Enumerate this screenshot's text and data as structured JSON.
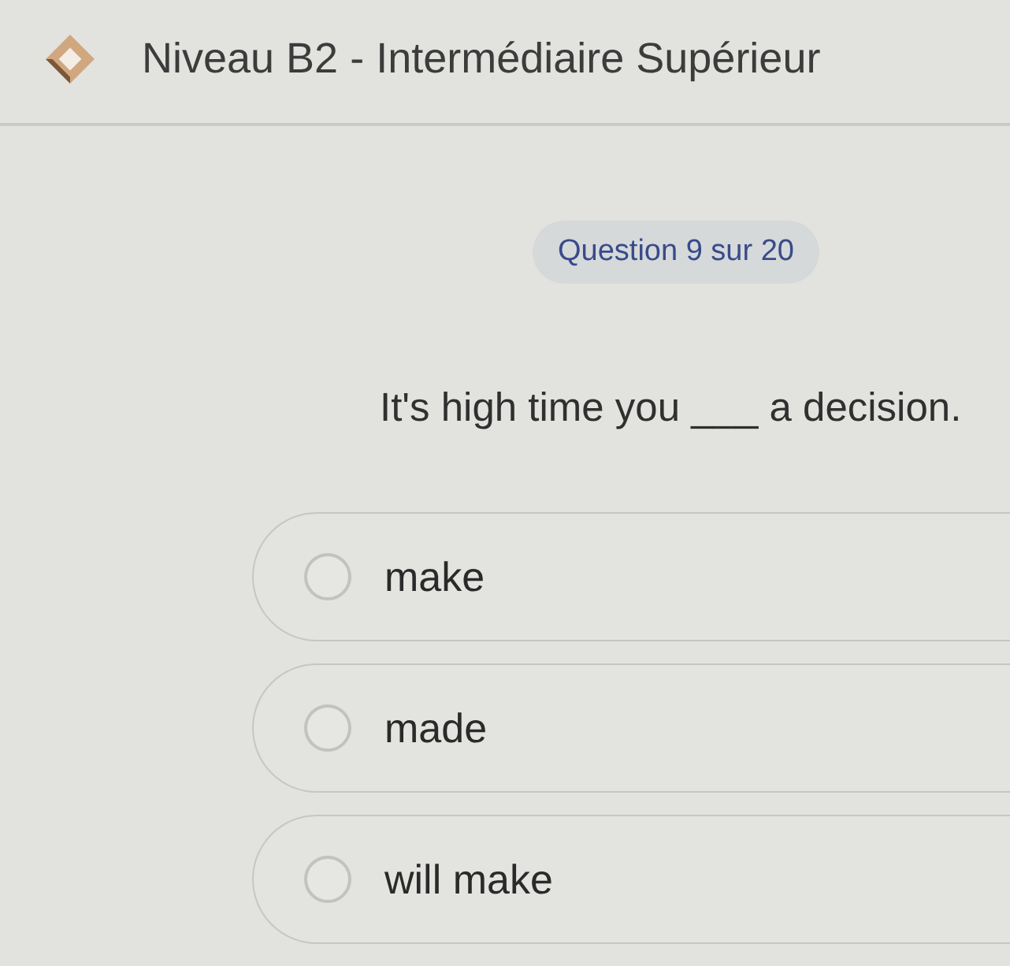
{
  "header": {
    "title": "Niveau B2 - Intermédiaire Supérieur"
  },
  "progress": {
    "label": "Question 9 sur 20"
  },
  "question": {
    "text": "It's high time you ___ a decision."
  },
  "options": [
    {
      "label": "make",
      "selected": false
    },
    {
      "label": "made",
      "selected": false
    },
    {
      "label": "will make",
      "selected": false
    }
  ]
}
